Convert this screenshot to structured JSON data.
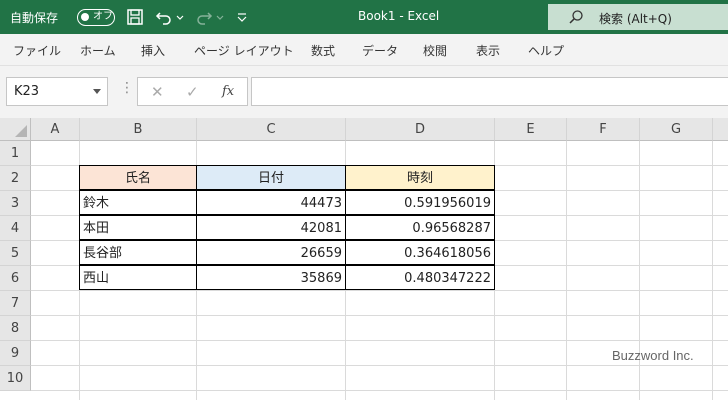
{
  "titlebar": {
    "autosave_label": "自動保存",
    "toggle_label": "オフ",
    "title": "Book1  -  Excel",
    "search_placeholder": "検索 (Alt+Q)"
  },
  "menu": [
    "ファイル",
    "ホーム",
    "挿入",
    "ページ レイアウト",
    "数式",
    "データ",
    "校閲",
    "表示",
    "ヘルプ"
  ],
  "formula_bar": {
    "name_box": "K23",
    "more_dots": "⋮",
    "cancel": "✕",
    "enter": "✓",
    "fx": "fx",
    "content": ""
  },
  "columns": [
    "A",
    "B",
    "C",
    "D",
    "E",
    "F",
    "G"
  ],
  "rows": [
    "1",
    "2",
    "3",
    "4",
    "5",
    "6",
    "7",
    "8",
    "9",
    "10"
  ],
  "table": {
    "headers": [
      "氏名",
      "日付",
      "時刻"
    ],
    "header_colors": [
      "#fce4d6",
      "#ddebf7",
      "#fff2cc"
    ],
    "rows": [
      [
        "鈴木",
        "44473",
        "0.591956019"
      ],
      [
        "本田",
        "42081",
        "0.96568287"
      ],
      [
        "長谷部",
        "26659",
        "0.364618056"
      ],
      [
        "西山",
        "35869",
        "0.480347222"
      ]
    ]
  },
  "watermark": "Buzzword Inc.",
  "colors": {
    "accent": "#217346"
  }
}
